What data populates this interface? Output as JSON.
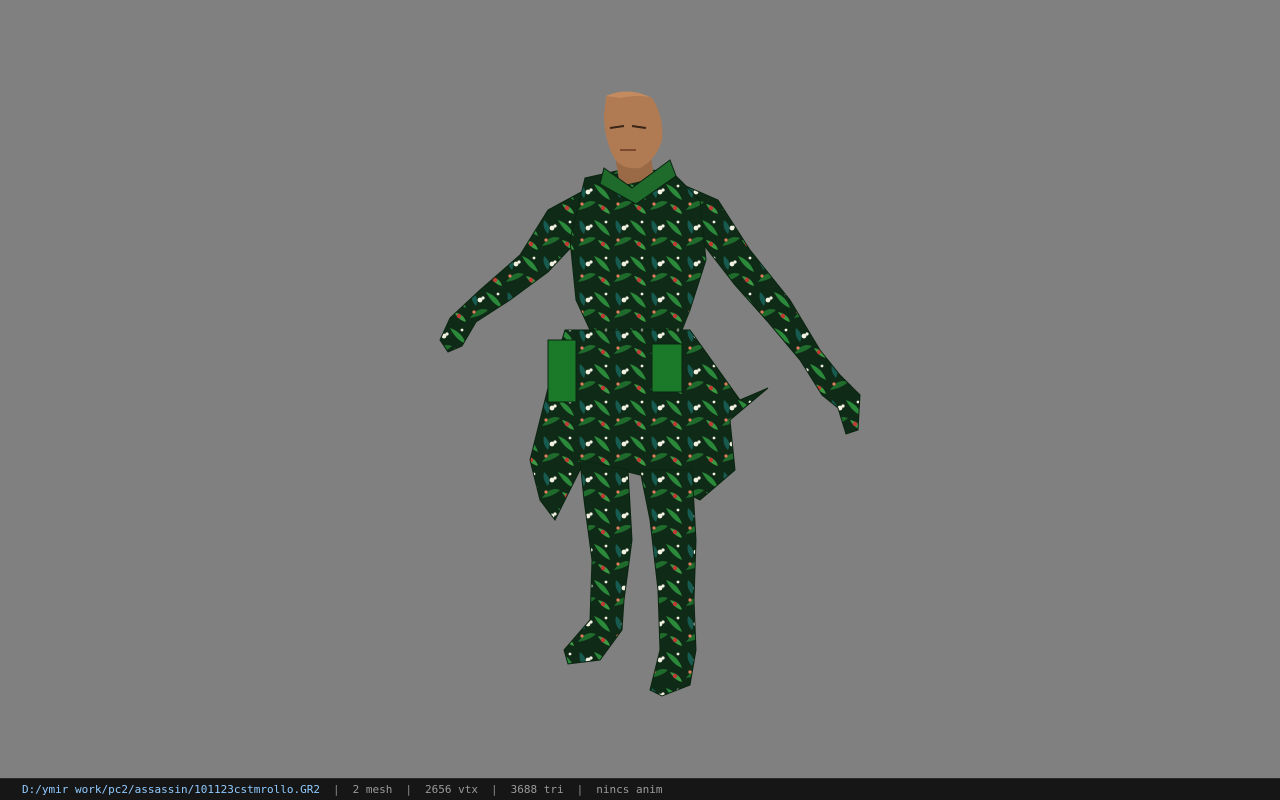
{
  "viewport": {
    "background": "#808080",
    "model": {
      "description_icon": "character-model",
      "skin_color": "#b07a52",
      "outfit_base_color": "#0f3a1a",
      "outfit_accent_color": "#2f8f3a",
      "flower_colors": [
        "#f2f2e6",
        "#c23a35",
        "#e07a5a"
      ]
    }
  },
  "status_bar": {
    "path": "D:/ymir work/pc2/assassin/101123cstmrollo.GR2",
    "separator": "|",
    "mesh": "2 mesh",
    "vtx": "2656 vtx",
    "tri": "3688 tri",
    "anim": "nincs anim"
  }
}
